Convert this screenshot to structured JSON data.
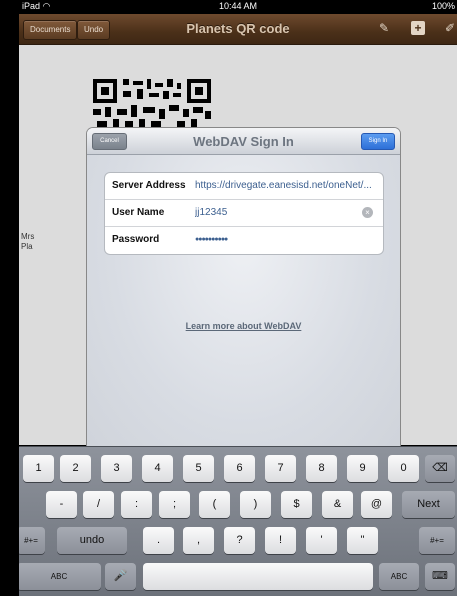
{
  "status_bar": {
    "device": "iPad",
    "time": "10:44 AM",
    "battery": "100%"
  },
  "toolbar": {
    "documents_label": "Documents",
    "undo_label": "Undo",
    "title": "Planets QR code",
    "icons": [
      "brush-icon",
      "add-icon",
      "tools-icon"
    ]
  },
  "document": {
    "text_line1": "Mrs",
    "text_line2": "Pla"
  },
  "dialog": {
    "title": "WebDAV Sign In",
    "cancel_label": "Cancel",
    "signin_label": "Sign In",
    "fields": {
      "server": {
        "label": "Server Address",
        "value": "https://drivegate.eanesisd.net/oneNet/..."
      },
      "user": {
        "label": "User Name",
        "value": "jj12345"
      },
      "password": {
        "label": "Password",
        "value": "●●●●●●●●●●"
      }
    },
    "learn_more": "Learn more about WebDAV"
  },
  "keyboard": {
    "row1": [
      "1",
      "2",
      "3",
      "4",
      "5",
      "6",
      "7",
      "8",
      "9",
      "0"
    ],
    "row2": [
      "-",
      "/",
      ":",
      ";",
      "(",
      ")",
      "$",
      "&",
      "@"
    ],
    "next_label": "Next",
    "row3_left": "#+=",
    "undo_label": "undo",
    "row3": [
      ".",
      ",",
      "?",
      "!",
      "'",
      "\""
    ],
    "row3_right": "#+=",
    "abc_left": "ABC",
    "abc_right": "ABC"
  }
}
